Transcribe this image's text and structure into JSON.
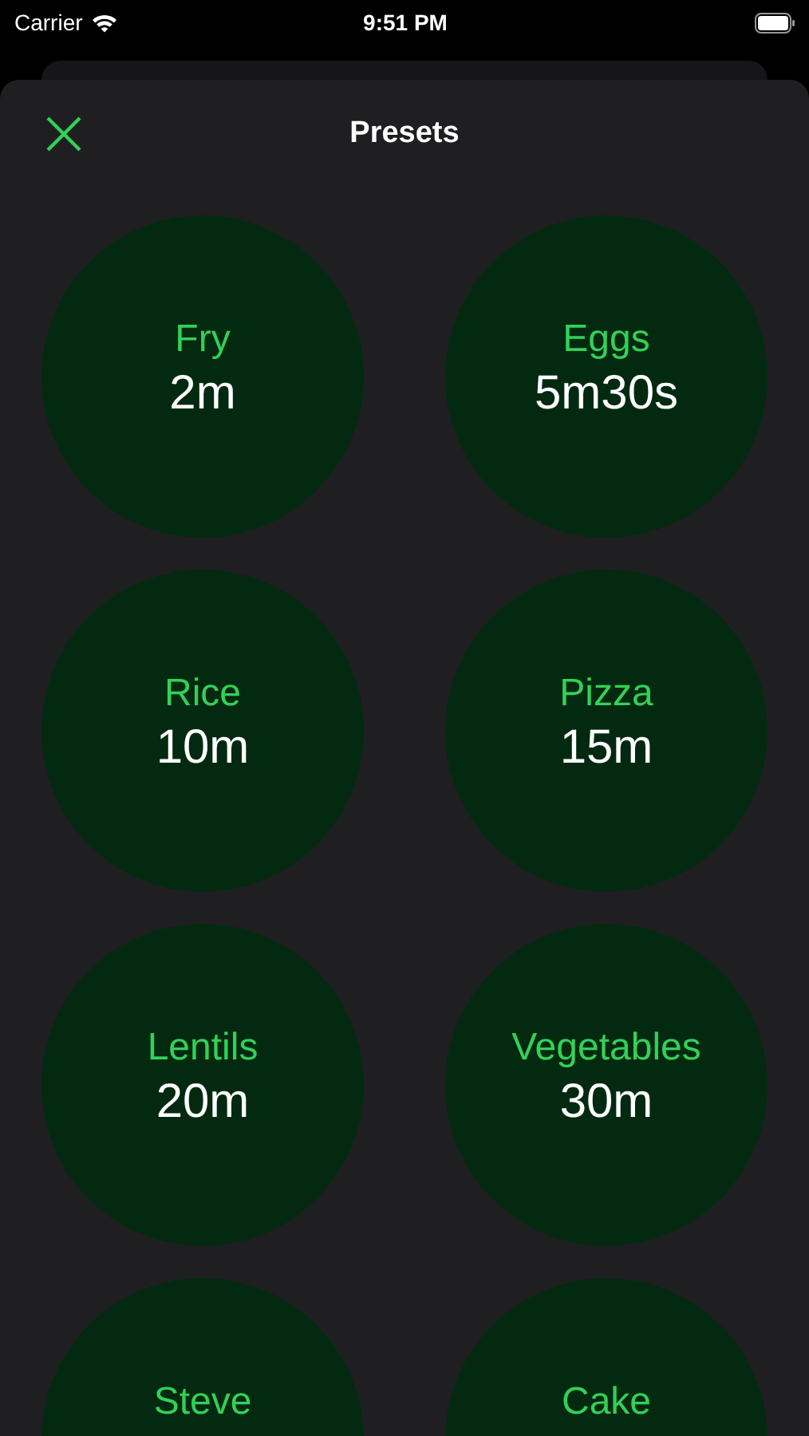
{
  "status_bar": {
    "carrier": "Carrier",
    "time": "9:51 PM"
  },
  "header": {
    "title": "Presets"
  },
  "presets": [
    {
      "name": "Fry",
      "duration": "2m"
    },
    {
      "name": "Eggs",
      "duration": "5m30s"
    },
    {
      "name": "Rice",
      "duration": "10m"
    },
    {
      "name": "Pizza",
      "duration": "15m"
    },
    {
      "name": "Lentils",
      "duration": "20m"
    },
    {
      "name": "Vegetables",
      "duration": "30m"
    },
    {
      "name": "Steve"
    },
    {
      "name": "Cake"
    }
  ]
}
